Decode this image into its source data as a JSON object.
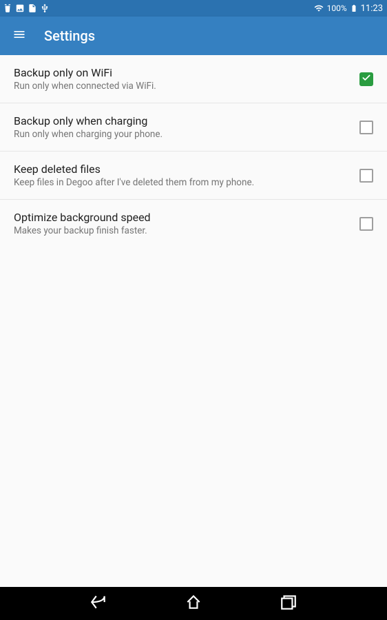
{
  "status": {
    "battery_pct": "100%",
    "time": "11:23"
  },
  "header": {
    "title": "Settings"
  },
  "settings": [
    {
      "id": "backup-wifi",
      "title": "Backup only on WiFi",
      "subtitle": "Run only when connected via WiFi.",
      "checked": true
    },
    {
      "id": "backup-charging",
      "title": "Backup only when charging",
      "subtitle": "Run only when charging your phone.",
      "checked": false
    },
    {
      "id": "keep-deleted",
      "title": "Keep deleted files",
      "subtitle": "Keep files in Degoo after I've deleted them from my phone.",
      "checked": false
    },
    {
      "id": "optimize-speed",
      "title": "Optimize background speed",
      "subtitle": "Makes your backup finish faster.",
      "checked": false
    }
  ]
}
